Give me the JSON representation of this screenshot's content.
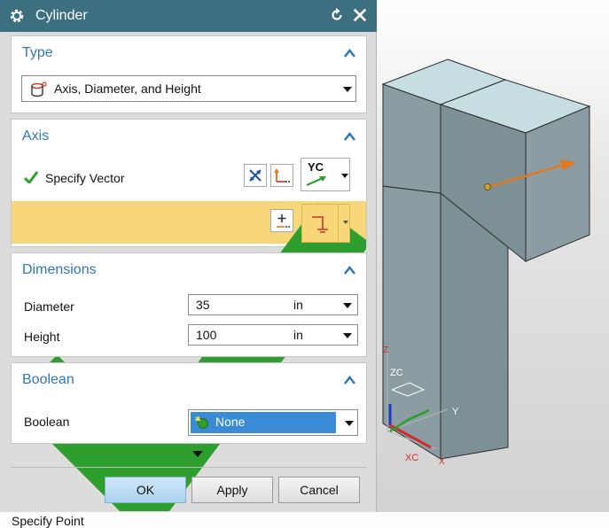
{
  "dialog": {
    "title": "Cylinder",
    "icons": {
      "settings": "gear-icon",
      "reset": "reset-icon",
      "close": "close-icon"
    }
  },
  "type_section": {
    "title": "Type",
    "selected": "Axis, Diameter, and Height"
  },
  "axis_section": {
    "title": "Axis",
    "specify_vector": "Specify Vector",
    "vector_combo_label": "YC",
    "specify_point": "Specify Point"
  },
  "dimensions_section": {
    "title": "Dimensions",
    "diameter_label": "Diameter",
    "diameter_value": "35",
    "diameter_unit": "in",
    "height_label": "Height",
    "height_value": "100",
    "height_unit": "in"
  },
  "boolean_section": {
    "title": "Boolean",
    "boolean_label": "Boolean",
    "boolean_value": "None"
  },
  "buttons": {
    "ok": "OK",
    "apply": "Apply",
    "cancel": "Cancel"
  },
  "viewport": {
    "axis_labels": {
      "z": "ZC",
      "y": "Y",
      "x": "XC",
      "x2": "X",
      "z2": "Z"
    }
  },
  "colors": {
    "titlebar": "#3c6f80",
    "section_title": "#2f78b6",
    "highlight_row": "#f8d77a",
    "selected_option": "#3a8bd6",
    "check": "#2e9e2e",
    "model_face_top": "#c6dde2",
    "model_face_front": "#7c9196",
    "vector_arrow": "#e07a22"
  }
}
